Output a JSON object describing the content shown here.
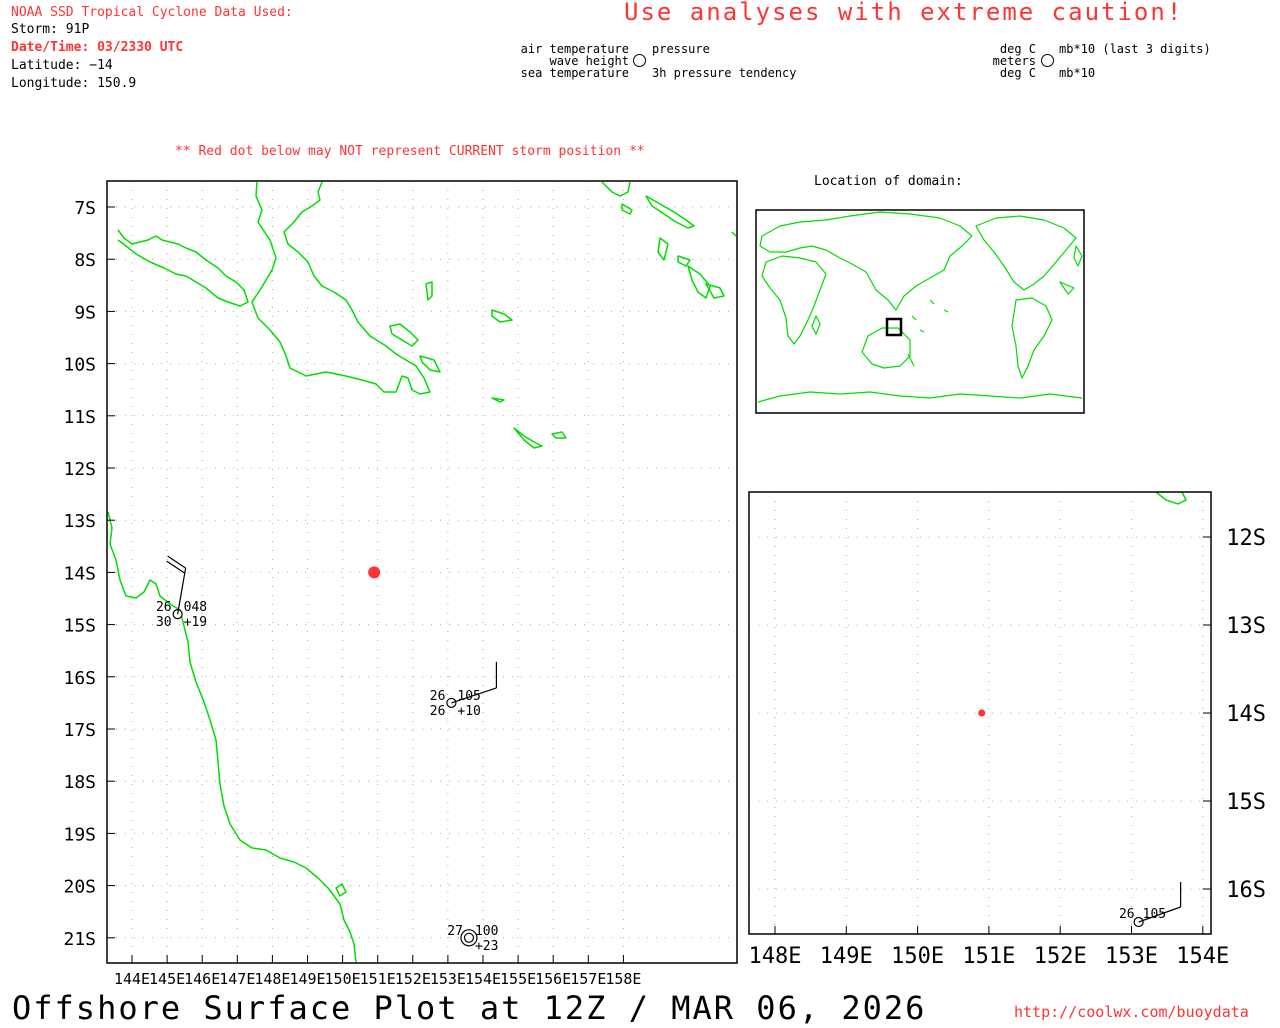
{
  "header": {
    "source_line": "NOAA SSD Tropical Cyclone Data Used:",
    "storm": "Storm: 91P",
    "datetime": "Date/Time: 03/2330 UTC",
    "latitude": "Latitude: −14",
    "longitude": "Longitude: 150.9",
    "caution": "Use analyses with extreme caution!"
  },
  "legend_left": {
    "air_temperature": "air temperature",
    "wave_height": "wave height",
    "sea_temperature": "sea temperature",
    "pressure": "pressure",
    "tendency": "3h pressure tendency"
  },
  "legend_right": {
    "deg_c_top": "deg C",
    "meters": "meters",
    "deg_c_bottom": "deg C",
    "mb_top": "mb*10 (last 3 digits)",
    "mb_bottom": "mb*10"
  },
  "red_dot_note": "** Red dot below may NOT represent CURRENT storm position **",
  "inset_title": "Location of domain:",
  "footer": {
    "title": "Offshore Surface Plot at 12Z / MAR 06, 2026",
    "url": "http://coolwx.com/buoydata"
  },
  "colors": {
    "coast": "#00dd00",
    "storm": "#ff3333",
    "grid": "#aaaaaa"
  },
  "main_map": {
    "lon_labels": [
      "144E",
      "145E",
      "146E",
      "147E",
      "148E",
      "149E",
      "150E",
      "151E",
      "152E",
      "153E",
      "154E",
      "155E",
      "156E",
      "157E",
      "158E"
    ],
    "lat_labels": [
      "7S",
      "8S",
      "9S",
      "10S",
      "11S",
      "12S",
      "13S",
      "14S",
      "15S",
      "16S",
      "17S",
      "18S",
      "19S",
      "20S",
      "21S"
    ],
    "storm_position": {
      "lon": 150.9,
      "lat": -14
    },
    "stations": [
      {
        "lon": 145.3,
        "lat": -14.8,
        "air_temp": "26",
        "sea_temp": "30",
        "pressure": "048",
        "tendency": "+19"
      },
      {
        "lon": 153.1,
        "lat": -16.5,
        "air_temp": "26",
        "sea_temp": "26",
        "pressure": "105",
        "tendency": "+10"
      },
      {
        "lon": 153.6,
        "lat": -21.0,
        "air_temp": "27",
        "sea_temp": "",
        "pressure": "100",
        "tendency": "+23"
      }
    ]
  },
  "zoom_map": {
    "lon_labels": [
      "148E",
      "149E",
      "150E",
      "151E",
      "152E",
      "153E",
      "154E"
    ],
    "lat_labels": [
      "12S",
      "13S",
      "14S",
      "15S",
      "16S"
    ],
    "storm_position": {
      "lon": 150.9,
      "lat": -14
    },
    "stations": [
      {
        "lon": 153.1,
        "lat": -16.5,
        "air_temp": "26",
        "pressure": "105"
      }
    ]
  }
}
